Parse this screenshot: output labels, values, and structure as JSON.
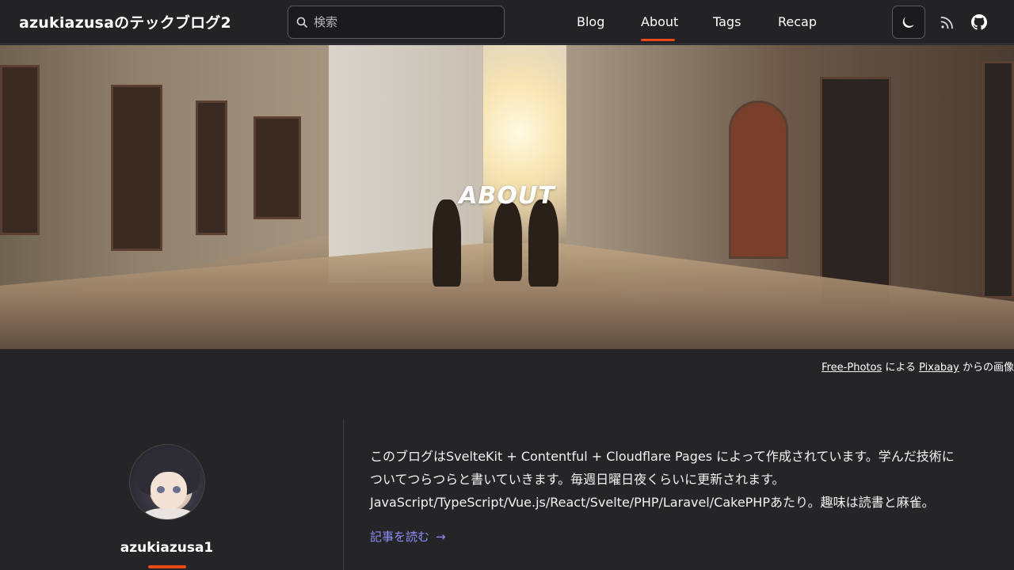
{
  "header": {
    "site_title": "azukiazusaのテックブログ2",
    "search_placeholder": "検索",
    "nav": [
      {
        "label": "Blog",
        "active": false
      },
      {
        "label": "About",
        "active": true
      },
      {
        "label": "Tags",
        "active": false
      },
      {
        "label": "Recap",
        "active": false
      }
    ],
    "accent_color": "#e84a1a",
    "icons": [
      "search-icon",
      "moon-icon",
      "rss-icon",
      "github-icon"
    ]
  },
  "hero": {
    "title": "ABOUT",
    "credit": {
      "author": "Free-Photos",
      "connector": " による ",
      "site": "Pixabay",
      "suffix": " からの画像"
    }
  },
  "profile": {
    "username": "azukiazusa1",
    "bio_lines": [
      "このブログはSvelteKit + Contentful + Cloudflare Pages によって作成されています。学んだ技術に",
      "ついてつらつらと書いていきます。毎週日曜日夜くらいに更新されます。",
      "JavaScript/TypeScript/Vue.js/React/Svelte/PHP/Laravel/CakePHPあたり。趣味は読書と麻雀。"
    ],
    "read_link": "記事を読む",
    "read_link_arrow": "→",
    "link_color": "#8f8dfa"
  }
}
